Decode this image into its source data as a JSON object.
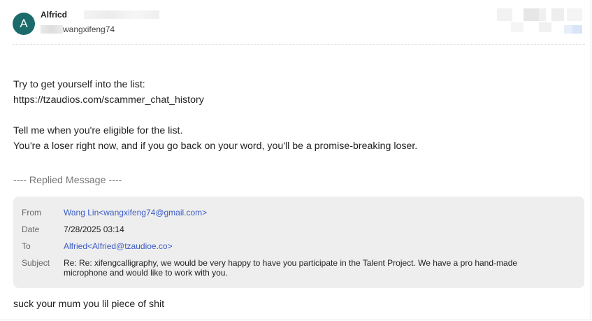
{
  "sender": {
    "avatar_letter": "A",
    "name": "Alfricd",
    "address": "wangxifeng74"
  },
  "body": {
    "line1": "Try to get yourself into the list:",
    "line2": "https://tzaudios.com/scammer_chat_history",
    "line3": "Tell me when you're eligible for the list.",
    "line4": "You're a loser right now, and if you go back on your word, you'll be a promise-breaking loser."
  },
  "replied_header": "---- Replied Message ----",
  "quote": {
    "from_label": "From",
    "from_value": "Wang Lin<wangxifeng74@gmail.com>",
    "date_label": "Date",
    "date_value": "7/28/2025 03:14",
    "to_label": "To",
    "to_value": "Alfried<Alfried@tzaudioe.co>",
    "subject_label": "Subject",
    "subject_line1": "Re: Re: xifengcalligraphy, we would be very happy to have you participate in the Talent Project. We have a pro hand-made",
    "subject_line2": "microphone and would like to work with you."
  },
  "footer_text": "suck your mum you lil piece of shit",
  "colors": {
    "avatar_bg": "#1b6b6b",
    "link": "#3b5cc6",
    "quote_bg": "#eeeeee"
  }
}
